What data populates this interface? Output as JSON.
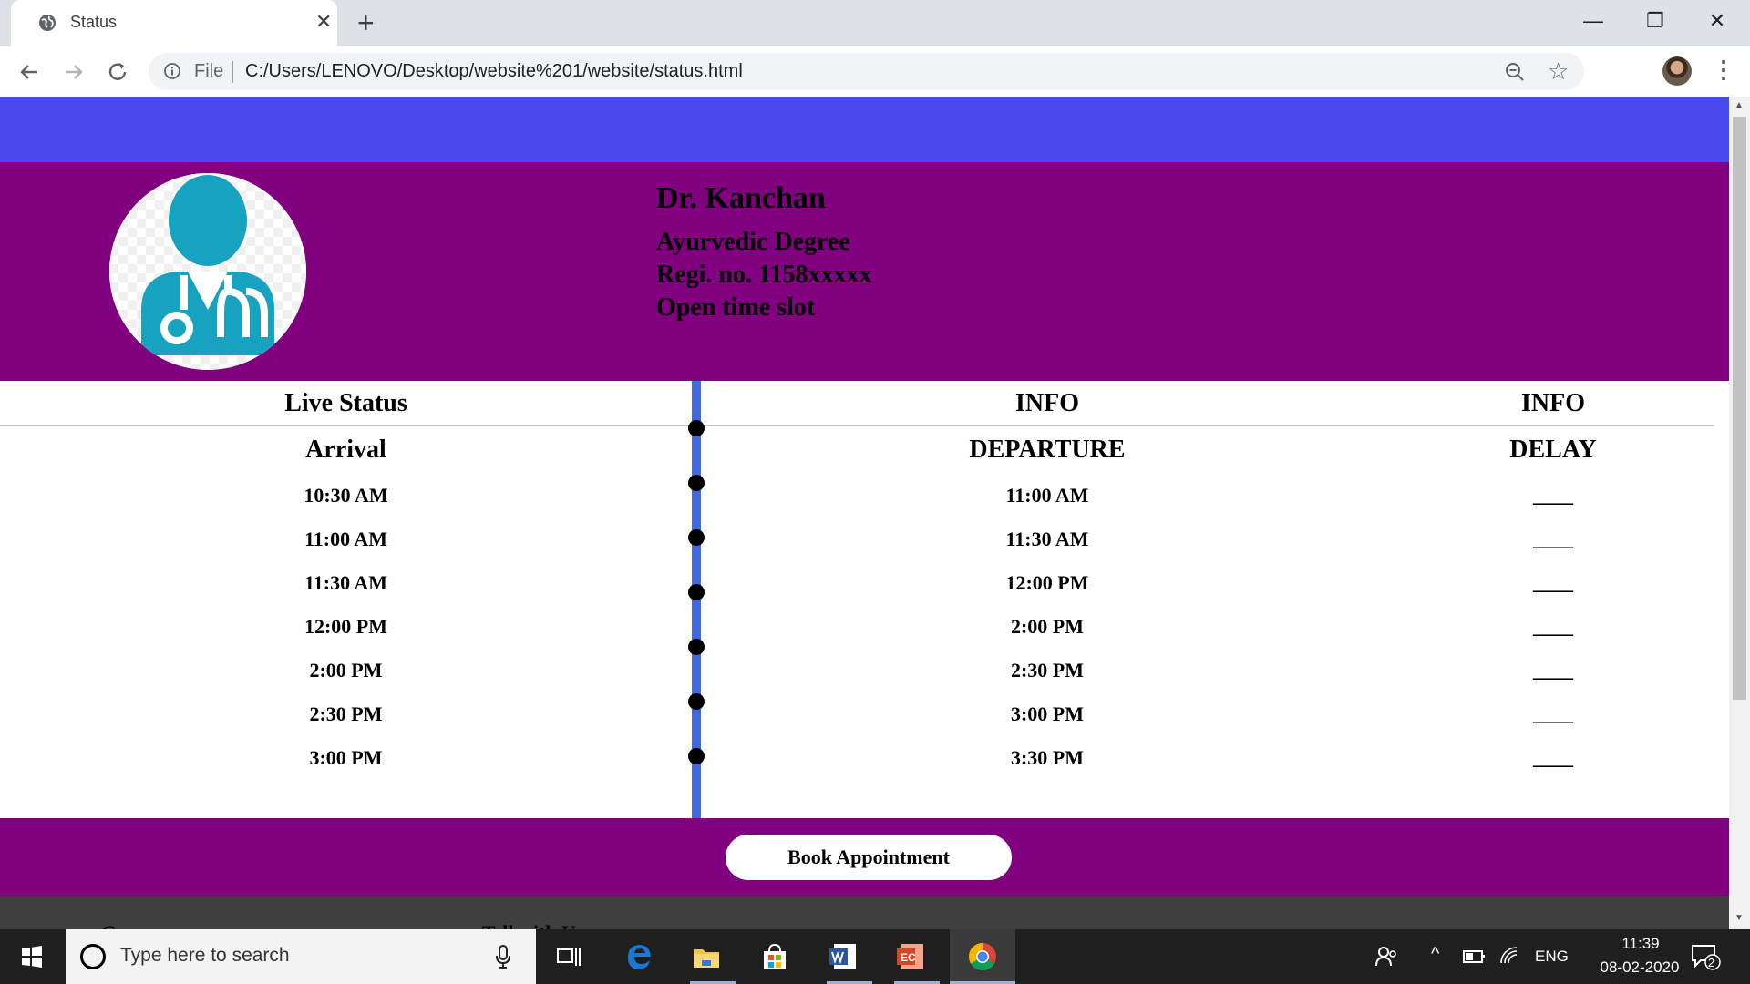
{
  "browser": {
    "tab_title": "Status",
    "tab_close": "✕",
    "new_tab": "+",
    "file_label": "File",
    "url": "C:/Users/LENOVO/Desktop/website%201/website/status.html",
    "window_minimize": "—",
    "window_restore": "❐",
    "window_close": "✕"
  },
  "profile": {
    "name": "Dr. Kanchan",
    "degree": "Ayurvedic Degree",
    "registration": "Regi. no. 1158xxxxx",
    "time_slot": "Open time slot"
  },
  "status": {
    "col1_head": "Live Status",
    "col2_head": "INFO",
    "col3_head": "INFO",
    "arrival_head": "Arrival",
    "departure_head": "DEPARTURE",
    "delay_head": "DELAY",
    "arrivals": [
      "10:30 AM",
      "11:00 AM",
      "11:30 AM",
      "12:00 PM",
      "2:00 PM",
      "2:30 PM",
      "3:00 PM"
    ],
    "departures": [
      "11:00 AM",
      "11:30 AM",
      "12:00 PM",
      "2:00 PM",
      "2:30 PM",
      "3:00 PM",
      "3:30 PM"
    ],
    "delays": [
      "____",
      "____",
      "____",
      "____",
      "____",
      "____",
      "____"
    ]
  },
  "actions": {
    "book_label": "Book Appointment"
  },
  "footer": {
    "items": [
      "Courses",
      "Tell with Us"
    ]
  },
  "taskbar": {
    "search_placeholder": "Type here to search",
    "language": "ENG",
    "time": "11:39",
    "date": "08-02-2020",
    "notification_count": "2"
  },
  "colors": {
    "blue_band": "#4949f0",
    "purple_band": "#800080",
    "timeline": "#4169e1",
    "avatar_teal": "#17a2c0"
  }
}
